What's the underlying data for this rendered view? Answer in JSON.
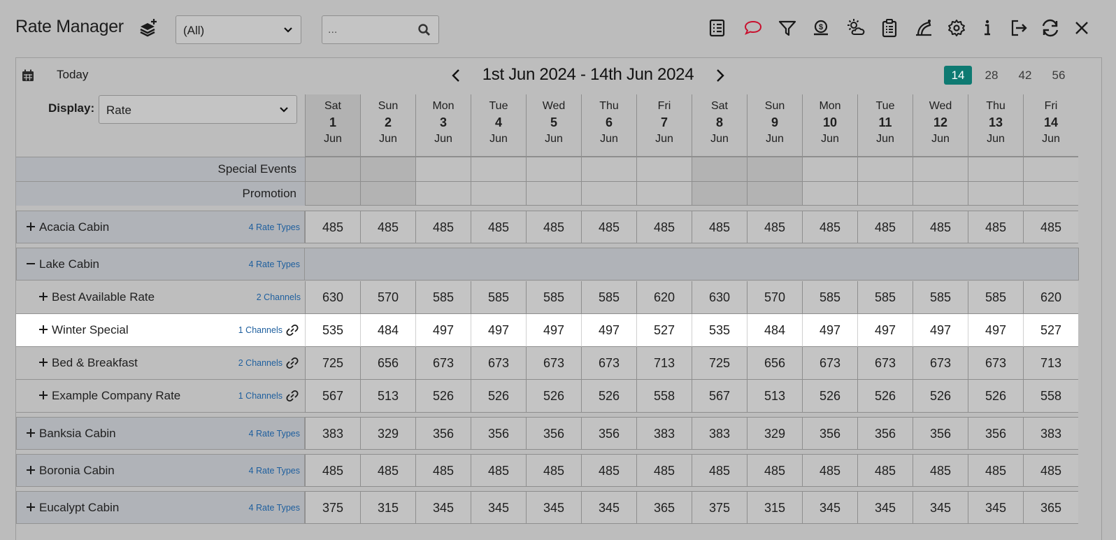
{
  "header": {
    "title": "Rate Manager",
    "filter_select": "(All)",
    "search_placeholder": "...",
    "tool_icons": [
      "list-icon",
      "comment-icon",
      "filter-icon",
      "money-bag-icon",
      "weather-icon",
      "clipboard-icon",
      "inspection-icon",
      "gear-icon",
      "info-icon",
      "exit-icon",
      "refresh-icon",
      "close-icon"
    ]
  },
  "toolbar": {
    "today_label": "Today",
    "date_range": "1st Jun 2024 - 14th Jun 2024",
    "range_options": [
      "14",
      "28",
      "42",
      "56"
    ],
    "active_range": "14",
    "display_label": "Display:",
    "display_value": "Rate"
  },
  "days": [
    {
      "name": "Sat",
      "date": "1",
      "month": "Jun",
      "weekend": true
    },
    {
      "name": "Sun",
      "date": "2",
      "month": "Jun",
      "weekend": true
    },
    {
      "name": "Mon",
      "date": "3",
      "month": "Jun",
      "weekend": false
    },
    {
      "name": "Tue",
      "date": "4",
      "month": "Jun",
      "weekend": false
    },
    {
      "name": "Wed",
      "date": "5",
      "month": "Jun",
      "weekend": false
    },
    {
      "name": "Thu",
      "date": "6",
      "month": "Jun",
      "weekend": false
    },
    {
      "name": "Fri",
      "date": "7",
      "month": "Jun",
      "weekend": false
    },
    {
      "name": "Sat",
      "date": "8",
      "month": "Jun",
      "weekend": true
    },
    {
      "name": "Sun",
      "date": "9",
      "month": "Jun",
      "weekend": true
    },
    {
      "name": "Mon",
      "date": "10",
      "month": "Jun",
      "weekend": false
    },
    {
      "name": "Tue",
      "date": "11",
      "month": "Jun",
      "weekend": false
    },
    {
      "name": "Wed",
      "date": "12",
      "month": "Jun",
      "weekend": false
    },
    {
      "name": "Thu",
      "date": "13",
      "month": "Jun",
      "weekend": false
    },
    {
      "name": "Fri",
      "date": "14",
      "month": "Jun",
      "weekend": false
    }
  ],
  "meta_rows": [
    "Special Events",
    "Promotion"
  ],
  "rows": [
    {
      "type": "cat",
      "expander": "+",
      "name": "Acacia Cabin",
      "tag": "4 Rate Types",
      "values": [
        485,
        485,
        485,
        485,
        485,
        485,
        485,
        485,
        485,
        485,
        485,
        485,
        485,
        485
      ]
    },
    {
      "type": "cat-open",
      "expander": "−",
      "name": "Lake Cabin",
      "tag": "4 Rate Types",
      "values": []
    },
    {
      "type": "sub",
      "expander": "+",
      "name": "Best Available Rate",
      "tag": "2 Channels",
      "linked": false,
      "values": [
        630,
        570,
        585,
        585,
        585,
        585,
        620,
        630,
        570,
        585,
        585,
        585,
        585,
        620
      ]
    },
    {
      "type": "sub",
      "expander": "+",
      "name": "Winter Special",
      "tag": "1 Channels",
      "linked": true,
      "highlight": true,
      "values": [
        535,
        484,
        497,
        497,
        497,
        497,
        527,
        535,
        484,
        497,
        497,
        497,
        497,
        527
      ]
    },
    {
      "type": "sub",
      "expander": "+",
      "name": "Bed & Breakfast",
      "tag": "2 Channels",
      "linked": true,
      "values": [
        725,
        656,
        673,
        673,
        673,
        673,
        713,
        725,
        656,
        673,
        673,
        673,
        673,
        713
      ]
    },
    {
      "type": "sub",
      "expander": "+",
      "name": "Example Company Rate",
      "tag": "1 Channels",
      "linked": true,
      "values": [
        567,
        513,
        526,
        526,
        526,
        526,
        558,
        567,
        513,
        526,
        526,
        526,
        526,
        558
      ]
    },
    {
      "type": "cat",
      "expander": "+",
      "name": "Banksia Cabin",
      "tag": "4 Rate Types",
      "values": [
        383,
        329,
        356,
        356,
        356,
        356,
        383,
        383,
        329,
        356,
        356,
        356,
        356,
        383
      ]
    },
    {
      "type": "cat",
      "expander": "+",
      "name": "Boronia Cabin",
      "tag": "4 Rate Types",
      "values": [
        485,
        485,
        485,
        485,
        485,
        485,
        485,
        485,
        485,
        485,
        485,
        485,
        485,
        485
      ]
    },
    {
      "type": "cat",
      "expander": "+",
      "name": "Eucalypt Cabin",
      "tag": "4 Rate Types",
      "values": [
        375,
        315,
        345,
        345,
        345,
        345,
        365,
        375,
        315,
        345,
        345,
        345,
        345,
        365
      ]
    }
  ],
  "colors": {
    "accent": "#0e7a72",
    "link_blue": "#1e5f9e",
    "comment_icon": "#c8102e"
  }
}
